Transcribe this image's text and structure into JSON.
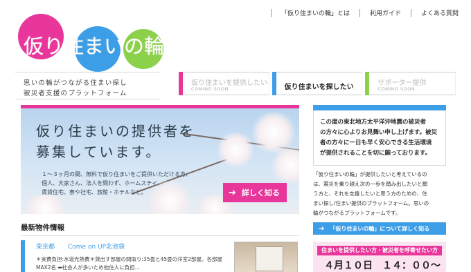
{
  "logo": {
    "text": "仮り住まいの輪"
  },
  "topnav": [
    {
      "label": "「仮り住まいの輪」とは"
    },
    {
      "label": "利用ガイド"
    },
    {
      "label": "よくある質問"
    }
  ],
  "tagline": {
    "line1": "思いの輪がつながる住まい探し",
    "line2": "被災者支援のプラットフォーム"
  },
  "tabs": [
    {
      "label": "仮り住まいを提供したい",
      "sub": "COMING SOON",
      "color": "#e8369a"
    },
    {
      "label": "仮り住まいを探したい",
      "sub": "",
      "color": "#3d9ee8"
    },
    {
      "label": "サポーター提供",
      "sub": "COMING SOON",
      "color": "#8cd14a"
    }
  ],
  "hero": {
    "headline1": "仮り住まいの提供者を",
    "headline2": "募集しています。",
    "body": [
      "１～３ヶ月の間、無料で仮り住まいをご提供いただける方、",
      "個人、大家さん、法人を問わず、ホームステイ、",
      "賃貸住宅、寮や社宅、旅館・ホテルなど。"
    ],
    "cta": "詳しく知る"
  },
  "latest": {
    "title": "最新物件情報",
    "item": {
      "area": "東京都",
      "name": "Come on UP北池袋",
      "desc": "＊実費負担:水道光熱費＊貸出す部屋の間取り:35畳と45畳の洋室2部屋。各部屋MAX2名 ➡社会人が多いため他住人に負担..."
    }
  },
  "right": {
    "message": [
      "この度の東北地方太平洋沖地震の被災者",
      "の方々に心よりお見舞い申し上げます。被災",
      "者の方々に一日も早く安心できる生活環境",
      "が提供されることを切に願っております。"
    ],
    "intro": [
      "「仮り住まいの輪」が提供したいと考えているの",
      "は、震災を乗り越え次の一歩を踏み出したいと願",
      "う方と、それを支援したいと思う方のための、住",
      "まい探し/住まい提供のプラットフォーム。思いの",
      "輪がつながるプラットフォームです。"
    ],
    "link": "「仮り住まいの輪」について詳しく知る",
    "event": {
      "caption": "住まいを提供したい方・被災者を呼寄せたい方",
      "date": "４月１０日　１４：００～"
    }
  },
  "colors": {
    "pink": "#e8369a",
    "blue": "#3d9ee8",
    "green": "#8cd14a"
  }
}
